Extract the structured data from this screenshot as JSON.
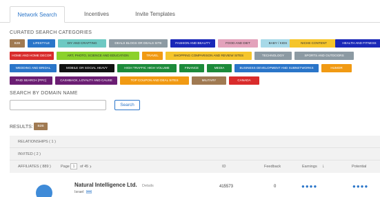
{
  "tabs": [
    {
      "label": "Network Search",
      "active": true
    },
    {
      "label": "Incentives",
      "active": false
    },
    {
      "label": "Invite Templates",
      "active": false
    }
  ],
  "curated": {
    "title": "CURATED SEARCH CATEGORIES",
    "rows": [
      [
        {
          "label": "B2B",
          "color": "#a07a52"
        },
        {
          "label": "LIFESTYLE",
          "color": "#2a75c9"
        },
        {
          "label": "DIY AND CRAFTING",
          "color": "#6dc9c3"
        },
        {
          "label": "DEALS BLOGS OR DEALS SITE",
          "color": "#8c9aa3"
        },
        {
          "label": "FASHION AND BEAUTY",
          "color": "#1a28b8"
        },
        {
          "label": "FOOD AND DIET",
          "color": "#e3a2bb"
        },
        {
          "label": "BABY / KIDS",
          "color": "#a7d9e8"
        },
        {
          "label": "NICHE CONTENT",
          "color": "#f5c52b"
        },
        {
          "label": "HEALTH AND FITNESS",
          "color": "#1a28b8"
        }
      ],
      [
        {
          "label": "HOME AND HOME DECOR",
          "color": "#d92c2c"
        },
        {
          "label": "ART, PHOTO, SCIENCE AND EDUCATION",
          "color": "#8bd12b"
        },
        {
          "label": "TRAVEL",
          "color": "#f19a13"
        },
        {
          "label": "SHOPPING COMPARISON AND REVIEW SITES",
          "color": "#f5c52b"
        },
        {
          "label": "TECHNOLOGY",
          "color": "#8c9aa3"
        },
        {
          "label": "SPORTS AND OUTDOORS",
          "color": "#8c9aa3"
        }
      ],
      [
        {
          "label": "WEDDING AND BRIDAL",
          "color": "#2a75c9"
        },
        {
          "label": "MOBILE OR SOCIAL HEAVY",
          "color": "#111111"
        },
        {
          "label": "HIGH TRAFFIC HIGH VOLUME",
          "color": "#1c8a3a"
        },
        {
          "label": "FINANCE",
          "color": "#1c8a3a"
        },
        {
          "label": "MEDIA",
          "color": "#1c8a3a"
        },
        {
          "label": "BUSINESS DEVELOPMENT AND SUBNETWORKS",
          "color": "#2a75c9"
        },
        {
          "label": "HUMOR",
          "color": "#f19a13"
        }
      ],
      [
        {
          "label": "PAID SEARCH (PPC)",
          "color": "#6b1e73"
        },
        {
          "label": "CASHBACK, LOYALTY AND CAUSE",
          "color": "#6b1e73"
        },
        {
          "label": "TOP COUPON AND DEAL SITES",
          "color": "#f19a13"
        },
        {
          "label": "MILITARY",
          "color": "#a07a52"
        },
        {
          "label": "CANADA",
          "color": "#d92c2c"
        }
      ]
    ]
  },
  "domain_search": {
    "title": "SEARCH BY DOMAIN NAME",
    "value": "",
    "button": "Search"
  },
  "results": {
    "label": "RESULTS:",
    "badge": "B2B",
    "relationships": "RELATIONSHIPS ( 1 )",
    "invited": "INVITED ( 2 )",
    "affiliates": "AFFILIATES ( 889 )",
    "page_prefix": "Page",
    "page_value": "1",
    "page_suffix": "of 45",
    "next_arrow": "›",
    "columns": {
      "id": "ID",
      "feedback": "Feedback",
      "earnings": "Earnings",
      "earnings_sort": "↓",
      "potential": "Potential"
    },
    "rows": [
      {
        "company": "Natural Intelligence Ltd.",
        "country": "Israel",
        "details": "Details",
        "id": "415573",
        "feedback": "0",
        "earnings": "●●●●",
        "potential": "●●●●"
      }
    ]
  }
}
